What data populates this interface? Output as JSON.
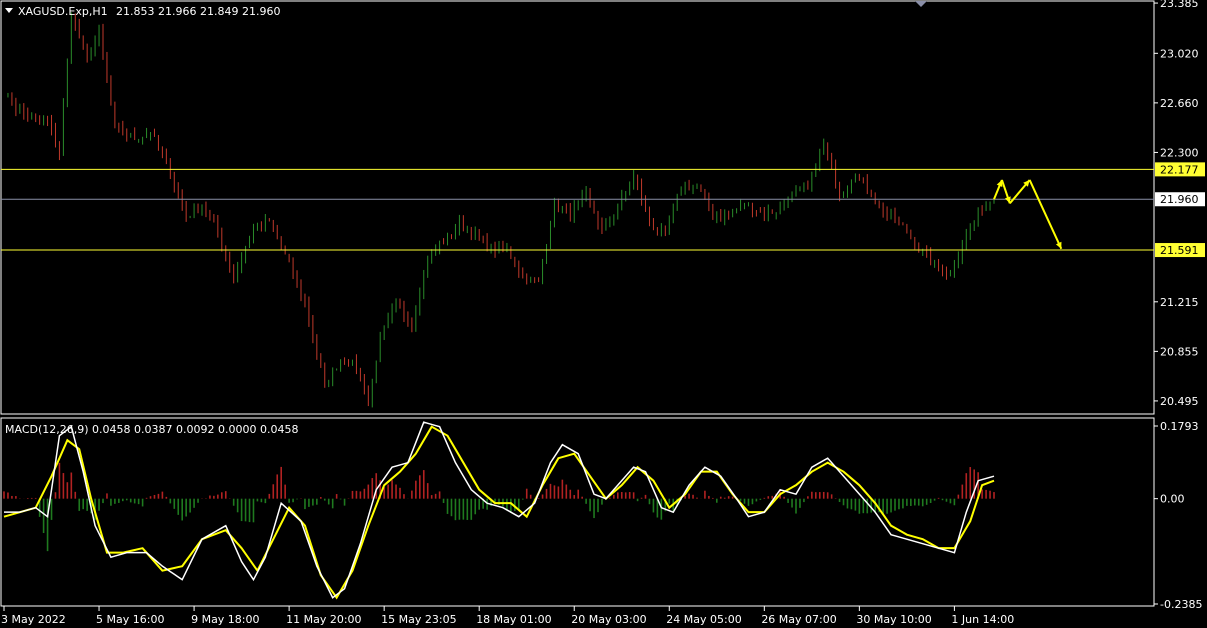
{
  "colors": {
    "background": "#000000",
    "frame": "#ffffff",
    "bull": "#2a8c2a",
    "bear": "#c0392b",
    "level": "#ffff33",
    "price_line": "#8a8fa8",
    "macd_main": "#ffffff",
    "macd_signal": "#ffff00",
    "hist_pos": "#b22222",
    "hist_neg": "#1f7a1f",
    "arrow": "#ffff00"
  },
  "header": {
    "menu_icon": "triangle-down-icon",
    "symbol": "XAGUSD.Exp,H1",
    "ohlc": "21.853 21.966 21.849 21.960"
  },
  "chart_data": [
    {
      "type": "candlestick",
      "symbol": "XAGUSD.Exp",
      "timeframe": "H1",
      "ylim": [
        20.4,
        23.4
      ],
      "y_ticks": [
        "23.385",
        "23.020",
        "22.660",
        "22.300",
        "21.215",
        "20.855",
        "20.495"
      ],
      "current_price": "21.960",
      "levels": [
        {
          "value": 22.177,
          "label": "22.177"
        },
        {
          "value": 21.591,
          "label": "21.591"
        }
      ],
      "close_anchors": [
        [
          0,
          22.75
        ],
        [
          3,
          22.62
        ],
        [
          8,
          22.53
        ],
        [
          11,
          22.52
        ],
        [
          14,
          22.3
        ],
        [
          17,
          23.3
        ],
        [
          21,
          22.98
        ],
        [
          24,
          23.18
        ],
        [
          28,
          22.48
        ],
        [
          33,
          22.4
        ],
        [
          37,
          22.45
        ],
        [
          41,
          22.23
        ],
        [
          46,
          21.83
        ],
        [
          50,
          21.92
        ],
        [
          53,
          21.8
        ],
        [
          58,
          21.4
        ],
        [
          63,
          21.75
        ],
        [
          67,
          21.8
        ],
        [
          71,
          21.55
        ],
        [
          76,
          21.2
        ],
        [
          81,
          20.6
        ],
        [
          85,
          20.8
        ],
        [
          89,
          20.75
        ],
        [
          92,
          20.5
        ],
        [
          95,
          20.95
        ],
        [
          99,
          21.2
        ],
        [
          103,
          21.05
        ],
        [
          107,
          21.55
        ],
        [
          111,
          21.65
        ],
        [
          115,
          21.78
        ],
        [
          119,
          21.7
        ],
        [
          123,
          21.6
        ],
        [
          127,
          21.6
        ],
        [
          131,
          21.4
        ],
        [
          135,
          21.35
        ],
        [
          139,
          21.93
        ],
        [
          143,
          21.85
        ],
        [
          147,
          22.0
        ],
        [
          151,
          21.73
        ],
        [
          155,
          21.9
        ],
        [
          159,
          22.13
        ],
        [
          163,
          21.8
        ],
        [
          167,
          21.7
        ],
        [
          171,
          22.05
        ],
        [
          175,
          22.05
        ],
        [
          179,
          21.85
        ],
        [
          183,
          21.83
        ],
        [
          187,
          21.93
        ],
        [
          191,
          21.86
        ],
        [
          195,
          21.88
        ],
        [
          199,
          22.0
        ],
        [
          203,
          22.05
        ],
        [
          207,
          22.35
        ],
        [
          211,
          22.0
        ],
        [
          215,
          22.15
        ],
        [
          219,
          22.0
        ],
        [
          223,
          21.85
        ],
        [
          227,
          21.76
        ],
        [
          231,
          21.6
        ],
        [
          235,
          21.48
        ],
        [
          239,
          21.42
        ],
        [
          243,
          21.7
        ],
        [
          247,
          21.9
        ],
        [
          250,
          21.96
        ]
      ],
      "projection": [
        [
          250,
          21.96
        ],
        [
          252,
          22.1
        ],
        [
          254,
          21.93
        ],
        [
          259,
          22.1
        ],
        [
          267,
          21.6
        ]
      ]
    },
    {
      "type": "macd",
      "title": "MACD(12,26,9) 0.0458 0.0387 0.0092 0.0000 0.0458",
      "ylim": [
        -0.2385,
        0.1793
      ],
      "y_ticks": [
        "0.1793",
        "0.00",
        "-0.2385"
      ],
      "main_anchors": [
        [
          0,
          -0.03
        ],
        [
          4,
          -0.03
        ],
        [
          8,
          -0.02
        ],
        [
          11,
          -0.04
        ],
        [
          14,
          0.14
        ],
        [
          17,
          0.16
        ],
        [
          20,
          0.06
        ],
        [
          23,
          -0.06
        ],
        [
          27,
          -0.13
        ],
        [
          31,
          -0.12
        ],
        [
          36,
          -0.12
        ],
        [
          40,
          -0.15
        ],
        [
          45,
          -0.18
        ],
        [
          50,
          -0.09
        ],
        [
          56,
          -0.06
        ],
        [
          60,
          -0.14
        ],
        [
          63,
          -0.18
        ],
        [
          66,
          -0.13
        ],
        [
          70,
          -0.01
        ],
        [
          75,
          -0.05
        ],
        [
          79,
          -0.15
        ],
        [
          83,
          -0.22
        ],
        [
          86,
          -0.2
        ],
        [
          90,
          -0.1
        ],
        [
          94,
          0.02
        ],
        [
          98,
          0.07
        ],
        [
          102,
          0.08
        ],
        [
          106,
          0.17
        ],
        [
          110,
          0.16
        ],
        [
          114,
          0.08
        ],
        [
          118,
          0.02
        ],
        [
          122,
          -0.01
        ],
        [
          126,
          -0.02
        ],
        [
          130,
          -0.04
        ],
        [
          134,
          -0.01
        ],
        [
          138,
          0.08
        ],
        [
          141,
          0.12
        ],
        [
          145,
          0.1
        ],
        [
          149,
          0.01
        ],
        [
          152,
          0.0
        ],
        [
          155,
          0.03
        ],
        [
          159,
          0.07
        ],
        [
          162,
          0.06
        ],
        [
          166,
          -0.02
        ],
        [
          169,
          -0.03
        ],
        [
          173,
          0.03
        ],
        [
          177,
          0.07
        ],
        [
          181,
          0.05
        ],
        [
          185,
          0.0
        ],
        [
          188,
          -0.04
        ],
        [
          192,
          -0.03
        ],
        [
          196,
          0.02
        ],
        [
          200,
          0.01
        ],
        [
          204,
          0.07
        ],
        [
          208,
          0.09
        ],
        [
          212,
          0.05
        ],
        [
          216,
          0.01
        ],
        [
          220,
          -0.03
        ],
        [
          224,
          -0.08
        ],
        [
          228,
          -0.09
        ],
        [
          232,
          -0.1
        ],
        [
          236,
          -0.11
        ],
        [
          240,
          -0.12
        ],
        [
          243,
          -0.03
        ],
        [
          246,
          0.04
        ],
        [
          250,
          0.05
        ]
      ],
      "signal_anchors": [
        [
          0,
          -0.04
        ],
        [
          4,
          -0.03
        ],
        [
          8,
          -0.02
        ],
        [
          12,
          0.05
        ],
        [
          16,
          0.13
        ],
        [
          19,
          0.11
        ],
        [
          22,
          0.0
        ],
        [
          26,
          -0.12
        ],
        [
          30,
          -0.12
        ],
        [
          35,
          -0.11
        ],
        [
          40,
          -0.16
        ],
        [
          45,
          -0.15
        ],
        [
          50,
          -0.09
        ],
        [
          56,
          -0.07
        ],
        [
          60,
          -0.11
        ],
        [
          64,
          -0.16
        ],
        [
          68,
          -0.09
        ],
        [
          72,
          -0.02
        ],
        [
          76,
          -0.06
        ],
        [
          80,
          -0.17
        ],
        [
          84,
          -0.22
        ],
        [
          88,
          -0.16
        ],
        [
          92,
          -0.06
        ],
        [
          96,
          0.03
        ],
        [
          100,
          0.06
        ],
        [
          104,
          0.1
        ],
        [
          108,
          0.16
        ],
        [
          112,
          0.14
        ],
        [
          116,
          0.08
        ],
        [
          120,
          0.02
        ],
        [
          124,
          -0.01
        ],
        [
          128,
          -0.01
        ],
        [
          132,
          -0.04
        ],
        [
          136,
          0.03
        ],
        [
          140,
          0.09
        ],
        [
          144,
          0.1
        ],
        [
          148,
          0.05
        ],
        [
          152,
          0.0
        ],
        [
          156,
          0.03
        ],
        [
          160,
          0.07
        ],
        [
          164,
          0.04
        ],
        [
          168,
          -0.02
        ],
        [
          172,
          0.01
        ],
        [
          176,
          0.06
        ],
        [
          180,
          0.06
        ],
        [
          184,
          0.01
        ],
        [
          188,
          -0.03
        ],
        [
          192,
          -0.03
        ],
        [
          196,
          0.01
        ],
        [
          200,
          0.03
        ],
        [
          204,
          0.06
        ],
        [
          208,
          0.08
        ],
        [
          212,
          0.06
        ],
        [
          216,
          0.03
        ],
        [
          220,
          -0.01
        ],
        [
          224,
          -0.06
        ],
        [
          228,
          -0.08
        ],
        [
          232,
          -0.09
        ],
        [
          236,
          -0.11
        ],
        [
          240,
          -0.11
        ],
        [
          244,
          -0.05
        ],
        [
          247,
          0.03
        ],
        [
          250,
          0.04
        ]
      ]
    }
  ],
  "x_ticks": [
    {
      "bar": 0,
      "label": "3 May 2022"
    },
    {
      "bar": 24,
      "label": "5 May 16:00"
    },
    {
      "bar": 48,
      "label": "9 May 18:00"
    },
    {
      "bar": 72,
      "label": "11 May 20:00"
    },
    {
      "bar": 96,
      "label": "15 May 23:05"
    },
    {
      "bar": 120,
      "label": "18 May 01:00"
    },
    {
      "bar": 144,
      "label": "20 May 03:00"
    },
    {
      "bar": 168,
      "label": "24 May 05:00"
    },
    {
      "bar": 192,
      "label": "26 May 07:00"
    },
    {
      "bar": 216,
      "label": "30 May 10:00"
    },
    {
      "bar": 240,
      "label": "1 Jun 14:00"
    }
  ]
}
